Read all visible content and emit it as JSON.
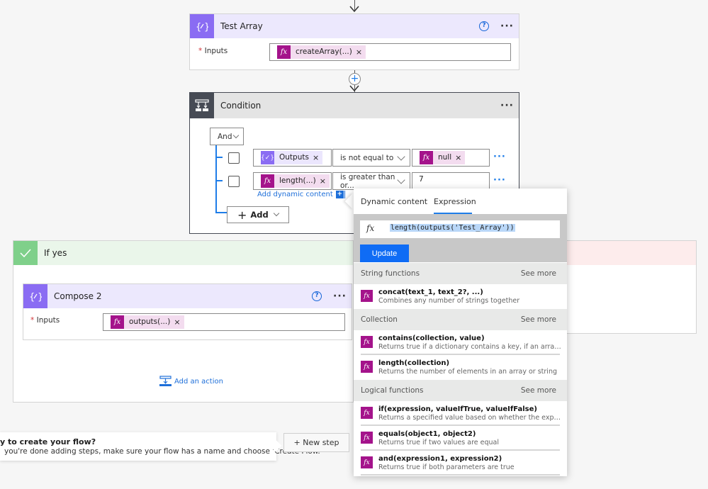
{
  "test_array_card": {
    "title": "Test Array",
    "inputs_label": "Inputs",
    "required_mark": "*",
    "token": {
      "icon": "fx",
      "label": "createArray(...)",
      "close": "×"
    },
    "help_icon": "?",
    "more_icon": "···"
  },
  "insert_step": {
    "icon": "+"
  },
  "condition_card": {
    "title": "Condition",
    "more_icon": "···",
    "group_operator": "And",
    "rows": [
      {
        "left_token": {
          "type": "variable",
          "icon": "{✓}",
          "label": "Outputs",
          "close": "×"
        },
        "operator": "is not equal to",
        "right_token": {
          "type": "expression",
          "icon": "fx",
          "label": "null",
          "close": "×"
        },
        "right_value": "",
        "more_icon": "···"
      },
      {
        "left_token": {
          "type": "expression",
          "icon": "fx",
          "label": "length(...)",
          "close": "×"
        },
        "operator": "is greater than or...",
        "right_value": "7",
        "more_icon": "···"
      }
    ],
    "add_dynamic_content": "Add dynamic content",
    "add_dynamic_icon": "+",
    "add_button": {
      "icon": "+",
      "label": "Add"
    }
  },
  "if_yes_branch": {
    "title": "If yes",
    "colors": {
      "header_bg": "#eaf6ea",
      "icon_bg": "#7fd08a"
    },
    "compose_card": {
      "title": "Compose 2",
      "inputs_label": "Inputs",
      "required_mark": "*",
      "token": {
        "icon": "fx",
        "label": "outputs(...)",
        "close": "×"
      },
      "help_icon": "?",
      "more_icon": "···"
    },
    "add_action": "Add an action"
  },
  "if_no_branch": {
    "colors": {
      "header_bg": "#fdecec"
    }
  },
  "expression_popup": {
    "tabs": [
      {
        "label": "Dynamic content",
        "active": false
      },
      {
        "label": "Expression",
        "active": true
      }
    ],
    "expression_icon": "fx",
    "expression_value": "length(outputs('Test_Array'))",
    "update_button": "Update",
    "sections": [
      {
        "name": "String functions",
        "see_more": "See more",
        "functions": [
          {
            "name": "concat(text_1, text_2?, ...)",
            "desc": "Combines any number of strings together"
          }
        ]
      },
      {
        "name": "Collection",
        "see_more": "See more",
        "functions": [
          {
            "name": "contains(collection, value)",
            "desc": "Returns true if a dictionary contains a key, if an array contai..."
          },
          {
            "name": "length(collection)",
            "desc": "Returns the number of elements in an array or string"
          }
        ]
      },
      {
        "name": "Logical functions",
        "see_more": "See more",
        "functions": [
          {
            "name": "if(expression, valueIfTrue, valueIfFalse)",
            "desc": "Returns a specified value based on whether the expression r..."
          },
          {
            "name": "equals(object1, object2)",
            "desc": "Returns true if two values are equal"
          },
          {
            "name": "and(expression1, expression2)",
            "desc": "Returns true if both parameters are true"
          }
        ]
      }
    ]
  },
  "footer": {
    "tip_title": "y to create your flow?",
    "tip_text": "you're done adding steps, make sure your flow has a name and choose 'Create Flow.'",
    "new_step_button": "+ New step"
  },
  "colors": {
    "accent_blue": "#1e7de8",
    "update_button": "#0f6cf5",
    "expression_purple": "#a4138b",
    "variable_purple": "#8a6cf3",
    "condition_dark": "#474b55"
  }
}
